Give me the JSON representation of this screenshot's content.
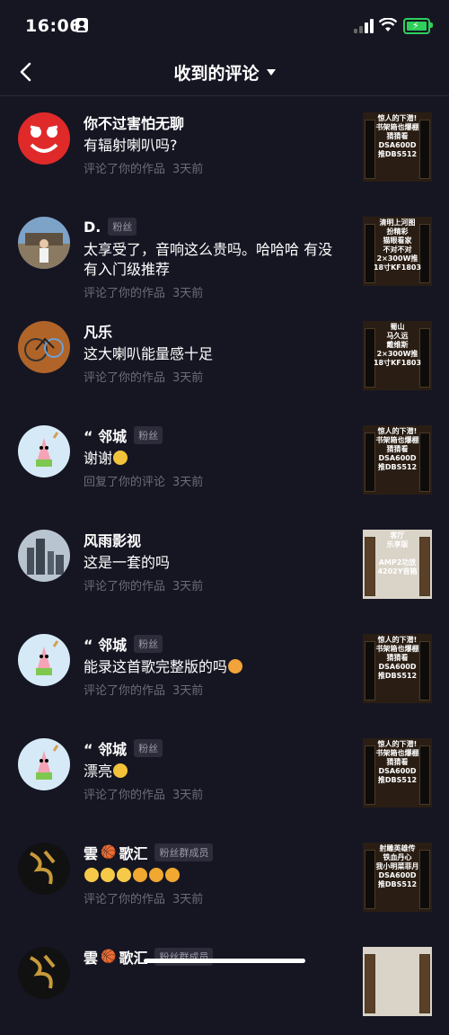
{
  "status": {
    "time": "16:06"
  },
  "nav": {
    "title": "收到的评论"
  },
  "items": [
    {
      "name": "你不过害怕无聊",
      "badge": "",
      "text": "有辐射喇叭吗?",
      "meta_action": "评论了你的作品",
      "meta_time": "3天前",
      "avatar": "red-smiley",
      "thumb_caption": "惊人的下潜!\n书架箱也爆棚\n猜猜看\nDSA600D\n推DBS512",
      "thumb_style": "dark"
    },
    {
      "name": "D.",
      "badge": "粉丝",
      "text": "太享受了，音响这么贵吗。哈哈哈 有没有入门级推荐",
      "meta_action": "评论了你的作品",
      "meta_time": "3天前",
      "avatar": "photo-person",
      "thumb_caption": "清明上河图\n扮精彩\n猫眼看家\n不对不对\n2×300W推\n18寸KF1803",
      "thumb_style": "dark"
    },
    {
      "name": "凡乐",
      "badge": "",
      "text": "这大喇叭能量感十足",
      "meta_action": "评论了你的作品",
      "meta_time": "3天前",
      "avatar": "photo-bike",
      "thumb_caption": "蜀山\n马久远\n戴维斯\n2×300W推\n18寸KF1803",
      "thumb_style": "dark"
    },
    {
      "name": "“ 邻城",
      "badge": "粉丝",
      "text": "谢谢",
      "emojis": [
        "thinking"
      ],
      "meta_action": "回复了你的评论",
      "meta_time": "3天前",
      "avatar": "patrick",
      "thumb_caption": "惊人的下潜!\n书架箱也爆棚\n猜猜看\nDSA600D\n推DBS512",
      "thumb_style": "dark"
    },
    {
      "name": "风雨影视",
      "badge": "",
      "text": "这是一套的吗",
      "meta_action": "评论了你的作品",
      "meta_time": "3天前",
      "avatar": "photo-city",
      "thumb_caption": "客厅\n乐享版\n\nAMP2功放\n4202Y音箱",
      "thumb_style": "light"
    },
    {
      "name": "“ 邻城",
      "badge": "粉丝",
      "text": "能录这首歌完整版的吗",
      "emojis": [
        "laugh"
      ],
      "meta_action": "评论了你的作品",
      "meta_time": "3天前",
      "avatar": "patrick",
      "thumb_caption": "惊人的下潜!\n书架箱也爆棚\n猜猜看\nDSA600D\n推DBS512",
      "thumb_style": "dark"
    },
    {
      "name": "“ 邻城",
      "badge": "粉丝",
      "text": "漂亮",
      "emojis": [
        "thinking"
      ],
      "meta_action": "评论了你的作品",
      "meta_time": "3天前",
      "avatar": "patrick",
      "thumb_caption": "惊人的下潜!\n书架箱也爆棚\n猜猜看\nDSA600D\n推DBS512",
      "thumb_style": "dark"
    },
    {
      "name": "雲",
      "name_suffix": "歌汇",
      "badge": "粉丝群成员",
      "text": "",
      "emojis": [
        "clap",
        "clap",
        "clap",
        "thumb",
        "thumb",
        "thumb"
      ],
      "meta_action": "评论了你的作品",
      "meta_time": "3天前",
      "avatar": "calligraphy",
      "thumb_caption": "射雕英雄传\n铁血丹心\n我小明菜菲月\nDSA600D\n推DBS512",
      "thumb_style": "dark"
    },
    {
      "name": "雲",
      "name_suffix": "歌汇",
      "badge": "粉丝群成员",
      "text": "",
      "meta_action": "",
      "meta_time": "",
      "avatar": "calligraphy",
      "thumb_caption": "",
      "thumb_style": "light"
    }
  ],
  "colors": {
    "background": "#161623",
    "meta": "#6c6c78",
    "badge_bg": "#2c2c3a",
    "battery": "#2ecf5b"
  }
}
